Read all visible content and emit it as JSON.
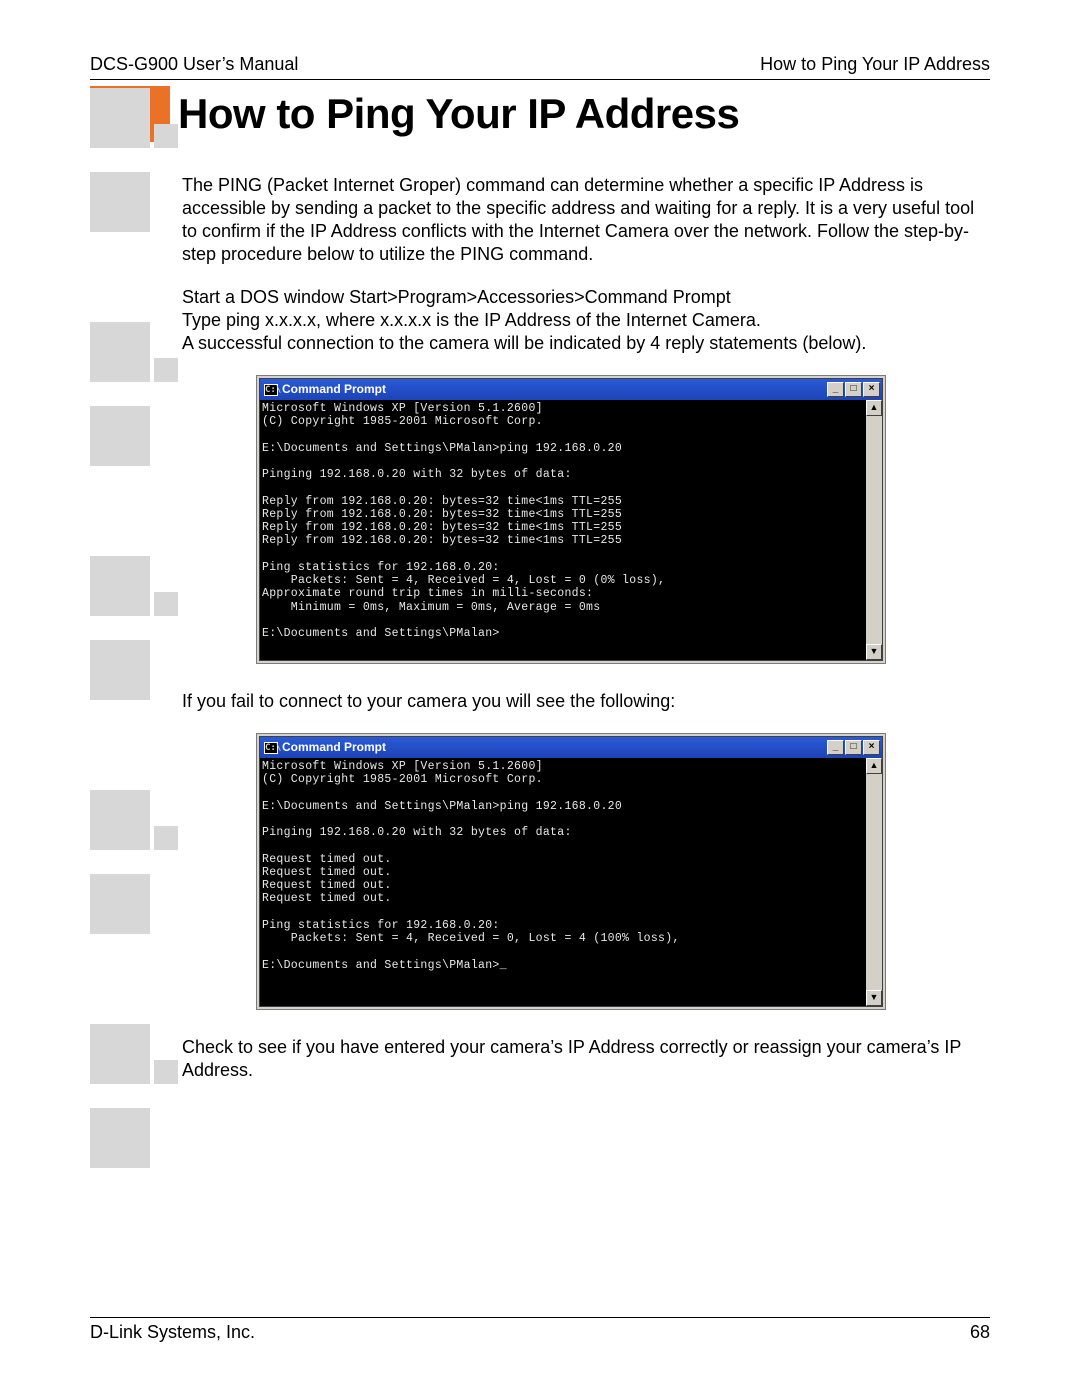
{
  "header": {
    "left": "DCS-G900 User’s Manual",
    "right": "How to Ping Your IP Address"
  },
  "title": "How to Ping Your IP Address",
  "para1": "The PING (Packet Internet Groper) command can determine whether a specific IP Address is accessible by sending a packet to the specific address and waiting for a reply. It is a very useful tool to confirm if the IP Address conflicts with the Internet Camera over the network. Follow the step-by-step procedure below to utilize the PING command.",
  "para2a": "Start a DOS window Start>Program>Accessories>Command Prompt",
  "para2b": "Type ping x.x.x.x, where x.x.x.x is the IP Address of the Internet Camera.",
  "para2c": "A successful connection to the camera will be indicated by 4 reply statements (below).",
  "para3": "If you fail to connect to your camera you will see the following:",
  "para4": "Check to see if you have entered your camera’s IP Address correctly or reassign your camera’s IP Address.",
  "cmd": {
    "title": "Command Prompt",
    "success": "Microsoft Windows XP [Version 5.1.2600]\n(C) Copyright 1985-2001 Microsoft Corp.\n\nE:\\Documents and Settings\\PMalan>ping 192.168.0.20\n\nPinging 192.168.0.20 with 32 bytes of data:\n\nReply from 192.168.0.20: bytes=32 time<1ms TTL=255\nReply from 192.168.0.20: bytes=32 time<1ms TTL=255\nReply from 192.168.0.20: bytes=32 time<1ms TTL=255\nReply from 192.168.0.20: bytes=32 time<1ms TTL=255\n\nPing statistics for 192.168.0.20:\n    Packets: Sent = 4, Received = 4, Lost = 0 (0% loss),\nApproximate round trip times in milli-seconds:\n    Minimum = 0ms, Maximum = 0ms, Average = 0ms\n\nE:\\Documents and Settings\\PMalan>",
    "fail": "Microsoft Windows XP [Version 5.1.2600]\n(C) Copyright 1985-2001 Microsoft Corp.\n\nE:\\Documents and Settings\\PMalan>ping 192.168.0.20\n\nPinging 192.168.0.20 with 32 bytes of data:\n\nRequest timed out.\nRequest timed out.\nRequest timed out.\nRequest timed out.\n\nPing statistics for 192.168.0.20:\n    Packets: Sent = 4, Received = 0, Lost = 4 (100% loss),\n\nE:\\Documents and Settings\\PMalan>_"
  },
  "footer": {
    "left": "D-Link Systems, Inc.",
    "page": "68"
  },
  "winbtn": {
    "min": "_",
    "max": "□",
    "close": "×"
  },
  "scroll": {
    "up": "▲",
    "down": "▼"
  },
  "cmdico": "C:\\"
}
